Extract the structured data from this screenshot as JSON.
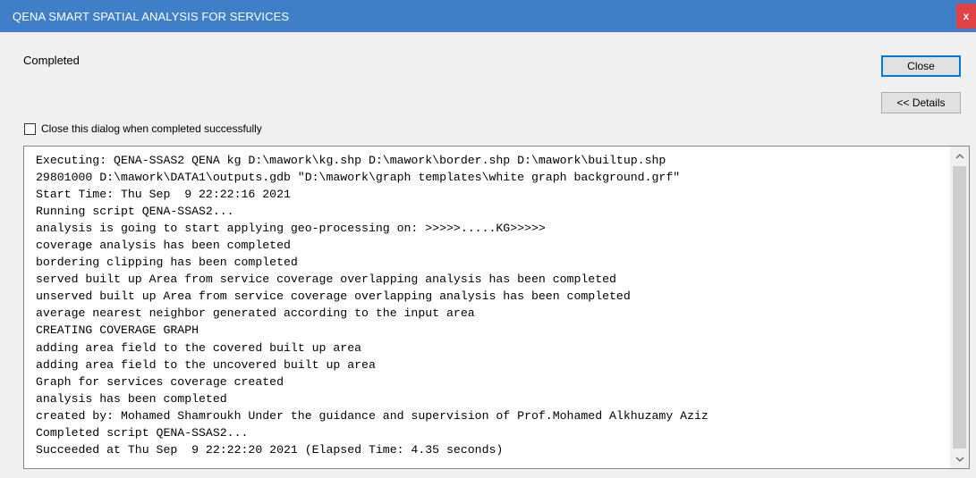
{
  "window": {
    "title": "QENA SMART SPATIAL ANALYSIS FOR SERVICES",
    "close_glyph": "x"
  },
  "status": "Completed",
  "buttons": {
    "close_label": "Close",
    "details_label": "<< Details"
  },
  "checkbox": {
    "label": "Close this dialog when completed successfully",
    "checked": false
  },
  "log": {
    "lines": [
      "Executing: QENA-SSAS2 QENA kg D:\\mawork\\kg.shp D:\\mawork\\border.shp D:\\mawork\\builtup.shp",
      "29801000 D:\\mawork\\DATA1\\outputs.gdb \"D:\\mawork\\graph templates\\white graph background.grf\"",
      "Start Time: Thu Sep  9 22:22:16 2021",
      "Running script QENA-SSAS2...",
      "analysis is going to start applying geo-processing on: >>>>>.....KG>>>>>",
      "coverage analysis has been completed",
      "bordering clipping has been completed",
      "served built up Area from service coverage overlapping analysis has been completed",
      "unserved built up Area from service coverage overlapping analysis has been completed",
      "average nearest neighbor generated according to the input area",
      "CREATING COVERAGE GRAPH",
      "adding area field to the covered built up area",
      "adding area field to the uncovered built up area",
      "Graph for services coverage created",
      "analysis has been completed",
      "created by: Mohamed Shamroukh Under the guidance and supervision of Prof.Mohamed Alkhuzamy Aziz",
      "Completed script QENA-SSAS2...",
      "Succeeded at Thu Sep  9 22:22:20 2021 (Elapsed Time: 4.35 seconds)"
    ]
  },
  "scrollbar": {
    "up_icon": "chevron-up-icon",
    "down_icon": "chevron-down-icon"
  },
  "colors": {
    "titlebar": "#3f7fc8",
    "close_button": "#e04343",
    "dialog_bg": "#f0f0f0",
    "focus_border": "#0078d7"
  }
}
